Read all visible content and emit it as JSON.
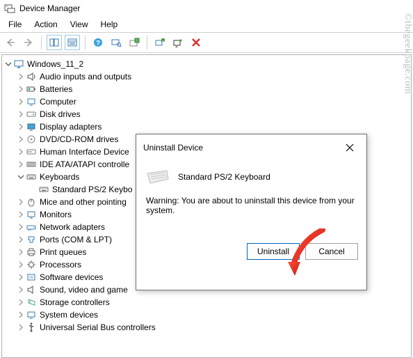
{
  "app": {
    "title": "Device Manager"
  },
  "menus": {
    "file": "File",
    "action": "Action",
    "view": "View",
    "help": "Help"
  },
  "tree": {
    "root": "Windows_11_2",
    "items": [
      "Audio inputs and outputs",
      "Batteries",
      "Computer",
      "Disk drives",
      "Display adapters",
      "DVD/CD-ROM drives",
      "Human Interface Device",
      "IDE ATA/ATAPI controlle",
      "Keyboards",
      "Standard PS/2 Keybo",
      "Mice and other pointing",
      "Monitors",
      "Network adapters",
      "Ports (COM & LPT)",
      "Print queues",
      "Processors",
      "Software devices",
      "Sound, video and game",
      "Storage controllers",
      "System devices",
      "Universal Serial Bus controllers"
    ]
  },
  "dialog": {
    "title": "Uninstall Device",
    "device": "Standard PS/2 Keyboard",
    "warning": "Warning: You are about to uninstall this device from your system.",
    "uninstall": "Uninstall",
    "cancel": "Cancel"
  },
  "watermark": "©thegeekpage.com"
}
